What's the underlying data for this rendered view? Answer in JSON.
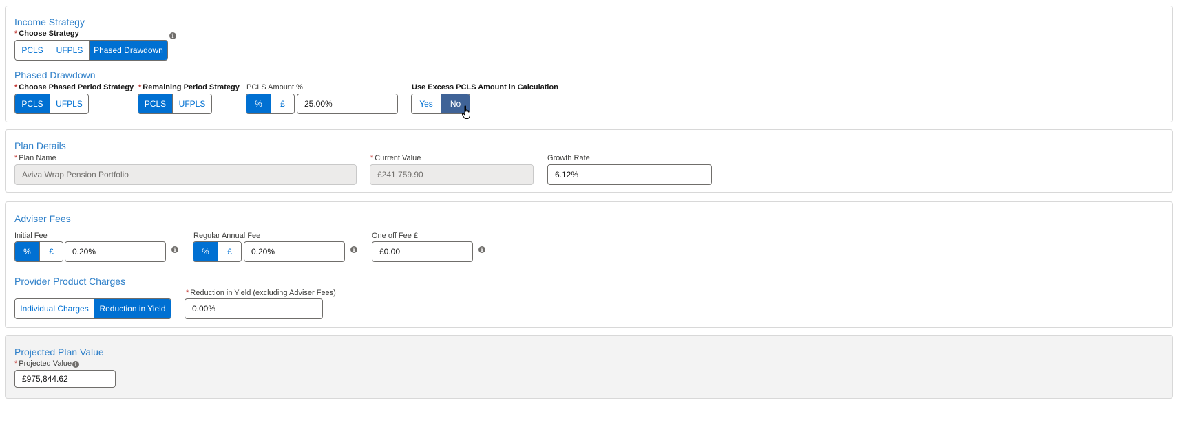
{
  "income_strategy": {
    "title": "Income Strategy",
    "choose_strategy_label": "Choose Strategy",
    "options": [
      "PCLS",
      "UFPLS",
      "Phased Drawdown"
    ],
    "selected": "Phased Drawdown"
  },
  "phased_drawdown": {
    "title": "Phased Drawdown",
    "phased_period": {
      "label": "Choose Phased Period Strategy",
      "options": [
        "PCLS",
        "UFPLS"
      ],
      "selected": "PCLS"
    },
    "remaining_period": {
      "label": "Remaining Period Strategy",
      "options": [
        "PCLS",
        "UFPLS"
      ],
      "selected": "PCLS"
    },
    "pcls_amount": {
      "label": "PCLS Amount %",
      "options": [
        "%",
        "£"
      ],
      "selected": "%",
      "value": "25.00%"
    },
    "use_excess": {
      "label": "Use Excess PCLS Amount in Calculation",
      "options": [
        "Yes",
        "No"
      ],
      "selected": "No"
    }
  },
  "plan_details": {
    "title": "Plan Details",
    "plan_name": {
      "label": "Plan Name",
      "value": "Aviva Wrap Pension Portfolio"
    },
    "current_value": {
      "label": "Current Value",
      "value": "£241,759.90"
    },
    "growth_rate": {
      "label": "Growth Rate",
      "value": "6.12%"
    }
  },
  "adviser_fees": {
    "title": "Adviser Fees",
    "initial_fee": {
      "label": "Initial Fee",
      "options": [
        "%",
        "£"
      ],
      "selected": "%",
      "value": "0.20%"
    },
    "regular_fee": {
      "label": "Regular Annual Fee",
      "options": [
        "%",
        "£"
      ],
      "selected": "%",
      "value": "0.20%"
    },
    "one_off_fee": {
      "label": "One off Fee £",
      "value": "£0.00"
    }
  },
  "provider_charges": {
    "title": "Provider Product Charges",
    "options": [
      "Individual Charges",
      "Reduction in Yield"
    ],
    "selected": "Reduction in Yield",
    "reduction": {
      "label": "Reduction in Yield (excluding Adviser Fees)",
      "value": "0.00%"
    }
  },
  "projected": {
    "title": "Projected Plan Value",
    "label": "Projected Value",
    "value": "£975,844.62"
  },
  "colors": {
    "accent": "#0070d2",
    "selected_dark": "#3f6397",
    "title_blue": "#2f80c9",
    "required": "#c23934"
  }
}
